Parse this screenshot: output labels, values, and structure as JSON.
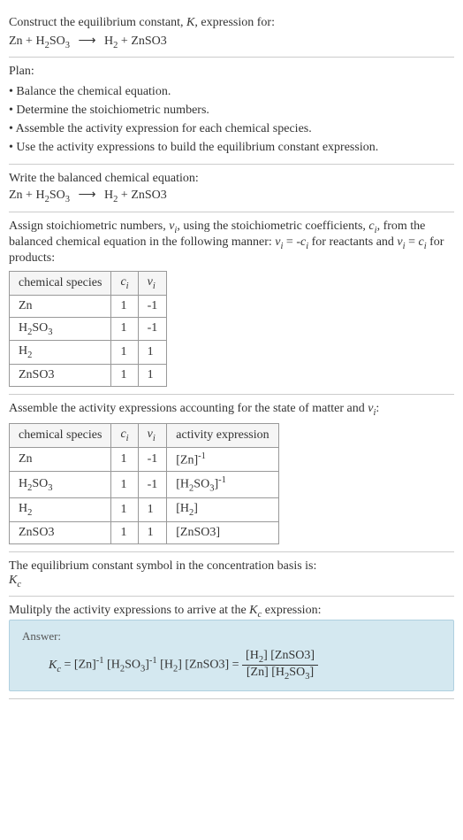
{
  "prompt": {
    "line1": "Construct the equilibrium constant, K, expression for:",
    "equation_lhs1": "Zn",
    "equation_lhs2": "H₂SO₃",
    "equation_rhs1": "H₂",
    "equation_rhs2": "ZnSO3"
  },
  "plan": {
    "title": "Plan:",
    "items": [
      "• Balance the chemical equation.",
      "• Determine the stoichiometric numbers.",
      "• Assemble the activity expression for each chemical species.",
      "• Use the activity expressions to build the equilibrium constant expression."
    ]
  },
  "balanced": {
    "title": "Write the balanced chemical equation:"
  },
  "stoich": {
    "intro1": "Assign stoichiometric numbers, νᵢ, using the stoichiometric coefficients, cᵢ, from the balanced chemical equation in the following manner: νᵢ = -cᵢ for reactants and νᵢ = cᵢ for products:",
    "headers": [
      "chemical species",
      "cᵢ",
      "νᵢ"
    ],
    "rows": [
      {
        "species": "Zn",
        "c": "1",
        "v": "-1"
      },
      {
        "species": "H₂SO₃",
        "c": "1",
        "v": "-1"
      },
      {
        "species": "H₂",
        "c": "1",
        "v": "1"
      },
      {
        "species": "ZnSO3",
        "c": "1",
        "v": "1"
      }
    ]
  },
  "activity": {
    "intro": "Assemble the activity expressions accounting for the state of matter and νᵢ:",
    "headers": [
      "chemical species",
      "cᵢ",
      "νᵢ",
      "activity expression"
    ],
    "rows": [
      {
        "species": "Zn",
        "c": "1",
        "v": "-1",
        "expr": "[Zn]⁻¹"
      },
      {
        "species": "H₂SO₃",
        "c": "1",
        "v": "-1",
        "expr": "[H₂SO₃]⁻¹"
      },
      {
        "species": "H₂",
        "c": "1",
        "v": "1",
        "expr": "[H₂]"
      },
      {
        "species": "ZnSO3",
        "c": "1",
        "v": "1",
        "expr": "[ZnSO3]"
      }
    ]
  },
  "symbol": {
    "line1": "The equilibrium constant symbol in the concentration basis is:",
    "line2": "K_c"
  },
  "multiply": {
    "line": "Mulitply the activity expressions to arrive at the K_c expression:"
  },
  "answer": {
    "label": "Answer:",
    "kc_label": "K_c",
    "prod1": "[Zn]⁻¹",
    "prod2": "[H₂SO₃]⁻¹",
    "prod3": "[H₂]",
    "prod4": "[ZnSO3]",
    "frac_top1": "[H₂]",
    "frac_top2": "[ZnSO3]",
    "frac_bot1": "[Zn]",
    "frac_bot2": "[H₂SO₃]"
  }
}
